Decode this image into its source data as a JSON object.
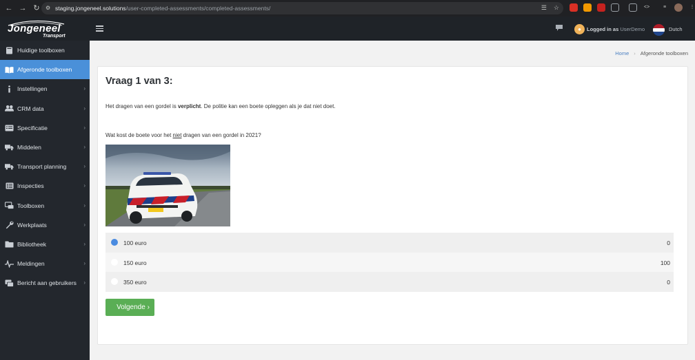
{
  "browser": {
    "url_host": "staging.jongeneel.solutions",
    "url_path": "/user-completed-assessments/completed-assessments/"
  },
  "header": {
    "logo_main": "Jongeneel",
    "logo_sub": "Transport",
    "logged_in_label": "Logged in as",
    "username": "UserDemo",
    "language": "Dutch"
  },
  "sidebar": {
    "items": [
      {
        "label": "Huidige toolboxen",
        "icon": "book-icon",
        "active": false,
        "chevron": false
      },
      {
        "label": "Afgeronde toolboxen",
        "icon": "open-book-icon",
        "active": true,
        "chevron": false
      },
      {
        "label": "Instellingen",
        "icon": "info-icon",
        "active": false,
        "chevron": true
      },
      {
        "label": "CRM data",
        "icon": "users-icon",
        "active": false,
        "chevron": true
      },
      {
        "label": "Specificatie",
        "icon": "list-card-icon",
        "active": false,
        "chevron": true
      },
      {
        "label": "Middelen",
        "icon": "truck-icon",
        "active": false,
        "chevron": true
      },
      {
        "label": "Transport planning",
        "icon": "truck-icon",
        "active": false,
        "chevron": true
      },
      {
        "label": "Inspecties",
        "icon": "checklist-icon",
        "active": false,
        "chevron": true
      },
      {
        "label": "Toolboxen",
        "icon": "toolbox-icon",
        "active": false,
        "chevron": true
      },
      {
        "label": "Werkplaats",
        "icon": "wrench-icon",
        "active": false,
        "chevron": true
      },
      {
        "label": "Bibliotheek",
        "icon": "folder-icon",
        "active": false,
        "chevron": true
      },
      {
        "label": "Meldingen",
        "icon": "pulse-icon",
        "active": false,
        "chevron": true
      },
      {
        "label": "Bericht aan gebruikers",
        "icon": "message-icon",
        "active": false,
        "chevron": true
      }
    ]
  },
  "breadcrumb": {
    "home": "Home",
    "current": "Afgeronde toolboxen"
  },
  "main": {
    "title": "Vraag 1 van 3:",
    "intro_before": "Het dragen van een gordel is ",
    "intro_bold": "verplicht",
    "intro_after": ". De politie kan een boete opleggen als je dat niet doet.",
    "question_before": "Wat kost de boete voor het ",
    "question_underlined": "niet",
    "question_after": " dragen van een gordel in 2021?",
    "options": [
      {
        "label": "100 euro",
        "score": "0",
        "selected": true
      },
      {
        "label": "150 euro",
        "score": "100",
        "selected": false
      },
      {
        "label": "350 euro",
        "score": "0",
        "selected": false
      }
    ],
    "next_button": "Volgende"
  },
  "colors": {
    "sidebar_bg": "#23272d",
    "sidebar_active": "#4a90d9",
    "header_bg": "#1f2328",
    "next_button": "#5aae55",
    "radio_selected": "#4a8be0"
  }
}
